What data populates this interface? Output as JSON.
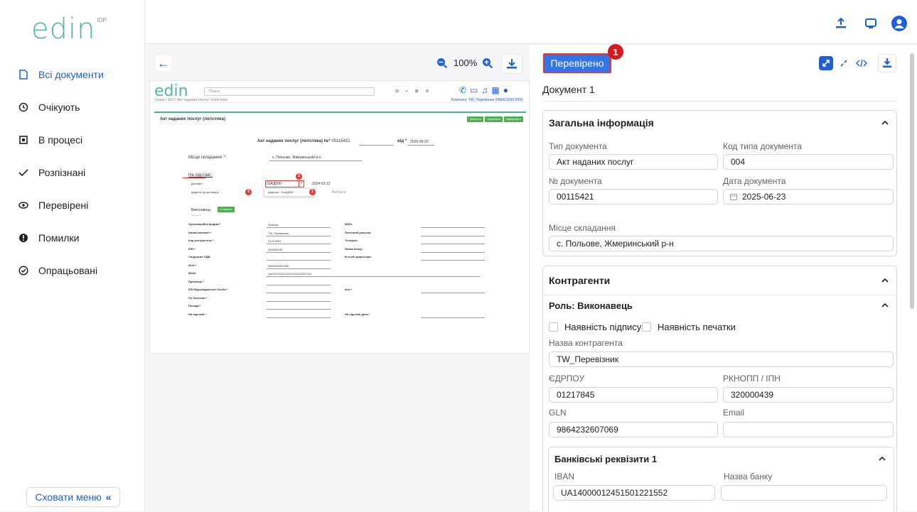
{
  "app": {
    "logo": "edin",
    "logo_sup": "IDP"
  },
  "sidebar": {
    "items": [
      {
        "label": "Всі документи",
        "icon": "document-icon"
      },
      {
        "label": "Очікують",
        "icon": "clock-icon"
      },
      {
        "label": "В процесі",
        "icon": "process-icon"
      },
      {
        "label": "Розпізнані",
        "icon": "check-icon"
      },
      {
        "label": "Перевірені",
        "icon": "eye-icon"
      },
      {
        "label": "Помилки",
        "icon": "error-icon"
      },
      {
        "label": "Опрацьовані",
        "icon": "check-circle-icon"
      }
    ],
    "hide_menu": "Сховати меню",
    "hide_menu_icon": "«"
  },
  "viewer": {
    "zoom": "100%",
    "preview": {
      "search_placeholder": "Пошук",
      "breadcrumb": "Сервіс / EDI / Акт наданих послуг (логістика)",
      "company": "Компанія: TW_Перевізник (9864232607069)",
      "doc_tab": "Акт наданих послуг (логістика)",
      "btn_save": "Зберегти",
      "btn_sign": "Підписати",
      "btn_send": "Відправити",
      "heading": "Акт наданих послуг (логістика) №*",
      "doc_number": "00115421",
      "date_label": "від *",
      "date": "2025-06-23",
      "place_label": "Місце складання :*",
      "place": "с. Польове, Жмеринський р-н",
      "basis_label": "На підставі :",
      "contract_label": "Договір:*",
      "contract_no": "01АД000",
      "contract_date": "2024-03-12",
      "addendum_label": "Додаток до договору:",
      "dropdown_item": "Додаток: \"01АД000\"",
      "select_placeholder": "Вибрати",
      "executor_label": "Виконавець",
      "executor_btn": "Створити",
      "executor_sub": "[продукт]",
      "rows": [
        {
          "l": "Організаційна форма:*",
          "v": "Фізична",
          "r": "МФО:",
          "rv": ""
        },
        {
          "l": "Назва компанії:*",
          "v": "TW_Перевізник",
          "r": "Поточний рахунок:",
          "rv": ""
        },
        {
          "l": "Код контрагента:*",
          "v": "01217845",
          "r": "Телефон:",
          "rv": ""
        },
        {
          "l": "ІПН:*",
          "v": "320000439",
          "r": "Назва банку:",
          "rv": ""
        },
        {
          "l": "Свідоцтво ПДВ:",
          "v": "",
          "r": "В особі директора:",
          "rv": ""
        },
        {
          "l": "GLN:*",
          "v": "9864232607069",
          "r": "",
          "rv": ""
        },
        {
          "l": "IBAN:",
          "v": "UA2222222222222222222222222",
          "r": "",
          "rv": ""
        },
        {
          "l": "Прізвище:*",
          "v": "",
          "r": "",
          "rv": ""
        },
        {
          "l": "ІПН Відповідальної Особи:*",
          "v": "",
          "r": "Ім'я:*",
          "rv": ""
        },
        {
          "l": "По батькові:*",
          "v": "",
          "r": "",
          "rv": ""
        },
        {
          "l": "Посада:*",
          "v": "",
          "r": "",
          "rv": ""
        },
        {
          "l": "На підставі:*",
          "v": "",
          "r": "На підставі дата:*",
          "rv": ""
        }
      ],
      "badges": [
        "1",
        "2",
        "3"
      ]
    }
  },
  "panel": {
    "verified_btn": "Перевірено",
    "badge": "1",
    "tab": "Документ 1",
    "general": {
      "title": "Загальна інформація",
      "doc_type_label": "Тип документа",
      "doc_type": "Акт наданих послуг",
      "doc_code_label": "Код типа документа",
      "doc_code": "004",
      "doc_no_label": "№ документа",
      "doc_no": "00115421",
      "doc_date_label": "Дата документа",
      "doc_date": "2025-06-23",
      "place_label": "Місце складання",
      "place": "с. Польове, Жмеринський р-н"
    },
    "parties": {
      "title": "Контрагенти",
      "role": "Роль: Виконавець",
      "sign_cb": "Наявність підпису",
      "stamp_cb": "Наявність печатки",
      "name_label": "Назва контрагента",
      "name": "TW_Перевізник",
      "edrpou_label": "ЄДРПОУ",
      "edrpou": "01217845",
      "rnokpp_label": "РКНОПП / ІПН",
      "rnokpp": "320000439",
      "gln_label": "GLN",
      "gln": "9864232607069",
      "email_label": "Email",
      "email": "",
      "bank": {
        "title": "Банківські реквізити 1",
        "iban_label": "IBAN",
        "iban": "UA14000012451501221552",
        "bank_name_label": "Назва банку",
        "bank_name": ""
      }
    }
  }
}
